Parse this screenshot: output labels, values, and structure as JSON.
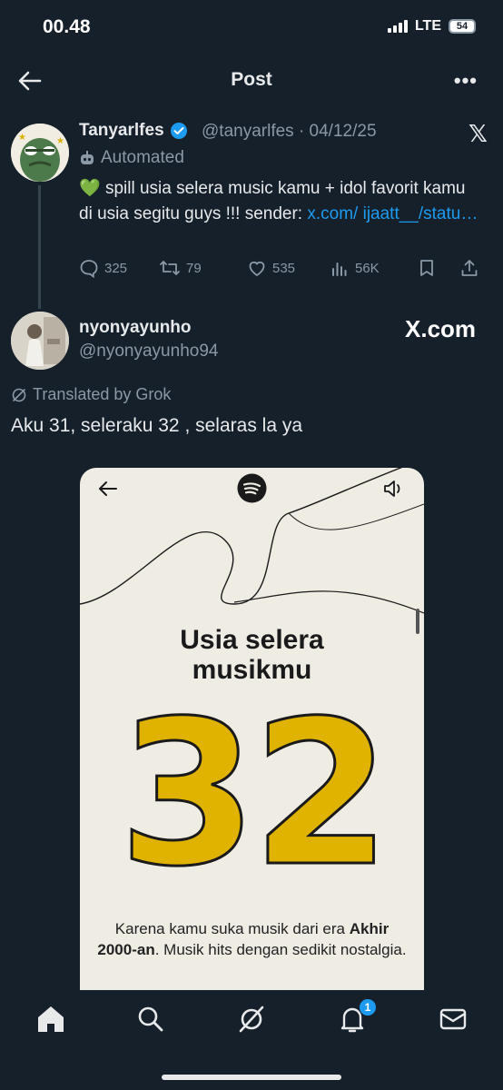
{
  "status": {
    "time": "00.48",
    "network": "LTE",
    "battery": "54"
  },
  "header": {
    "title": "Post",
    "back_icon": "arrow-left-icon",
    "more_label": "•••"
  },
  "post": {
    "author": "Tanyarlfes",
    "handle": "@tanyarlfes · 04/12/25",
    "automated_label": "Automated",
    "emoji": "💚",
    "text": " spill usia selera music kamu + idol favorit kamu di usia segitu guys !!! sender: ",
    "link_text": "x.com/ ijaatt__/statu…",
    "metrics": {
      "replies": "325",
      "reposts": "79",
      "likes": "535",
      "views": "56K"
    },
    "badge_color": "#1d9bf0"
  },
  "reply": {
    "author": "nyonyayunho",
    "handle": "@nyonyayunho94",
    "watermark": "X.com",
    "translated_label": "Translated by Grok",
    "text": "Aku 31, seleraku 32 , selaras la ya"
  },
  "card": {
    "title_line1": "Usia selera",
    "title_line2": "musikmu",
    "number": "32",
    "number_color": "#e0b300",
    "caption_pre": "Karena kamu suka musik dari era ",
    "caption_bold": "Akhir 2000-an",
    "caption_post": ". Musik hits dengan sedikit nostalgia."
  },
  "tabbar": {
    "notification_count": "1"
  }
}
